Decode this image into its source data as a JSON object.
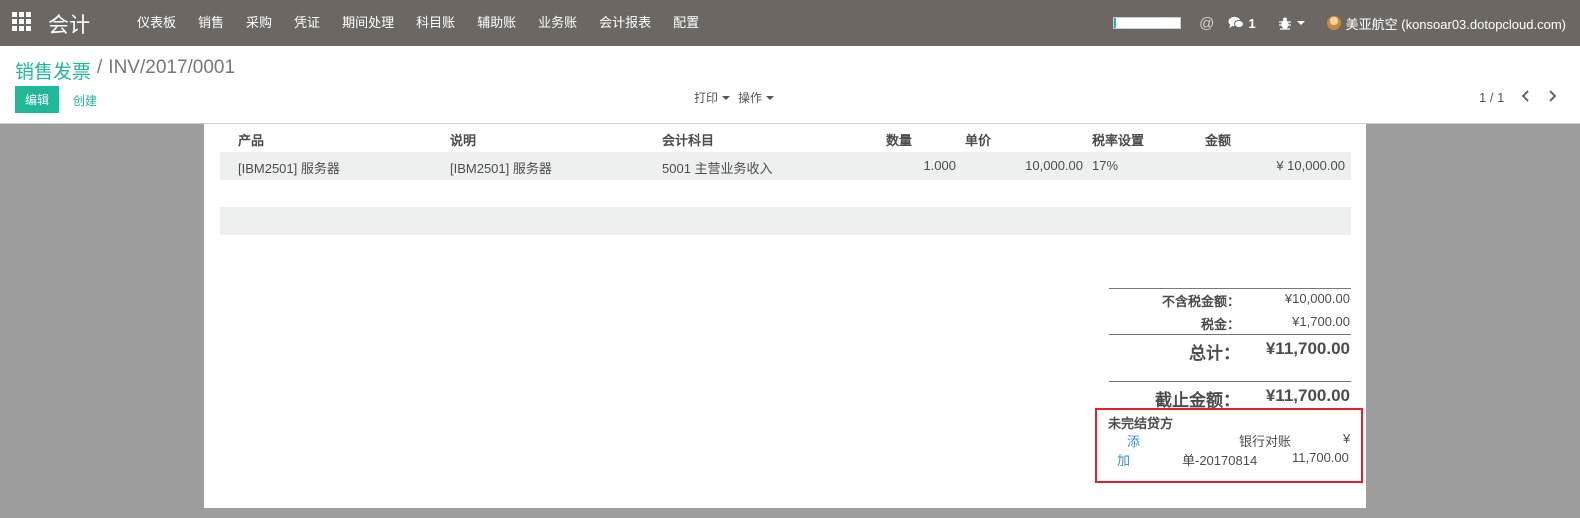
{
  "navbar": {
    "app_title": "会计",
    "menu": [
      "仪表板",
      "销售",
      "采购",
      "凭证",
      "期间处理",
      "科目账",
      "辅助账",
      "业务账",
      "会计报表",
      "配置"
    ],
    "progress_fraction": 0.03,
    "at_symbol": "@",
    "chat_count": "1",
    "user_name": "美亚航空 (konsoar03.dotopcloud.com)",
    "accent_color": "#21b799",
    "bar_color": "#6c6762"
  },
  "control": {
    "breadcrumb_parent": "销售发票",
    "breadcrumb_separator": "/",
    "breadcrumb_current": "INV/2017/0001",
    "edit_label": "编辑",
    "create_label": "创建",
    "print_label": "打印",
    "action_label": "操作",
    "pager_text": "1 / 1"
  },
  "lines": {
    "headers": {
      "product": "产品",
      "description": "说明",
      "account": "会计科目",
      "quantity": "数量",
      "unit_price": "单价",
      "tax": "税率设置",
      "amount": "金额"
    },
    "rows": [
      {
        "product": "[IBM2501] 服务器",
        "description": "[IBM2501] 服务器",
        "account": "5001 主营业务收入",
        "quantity": "1.000",
        "unit_price": "10,000.00",
        "tax": "17%",
        "amount": "¥ 10,000.00"
      }
    ]
  },
  "totals": {
    "untaxed_label": "不含税金额：",
    "untaxed_value": "¥10,000.00",
    "tax_label": "税金：",
    "tax_value": "¥1,700.00",
    "total_label": "总计：",
    "total_value": "¥11,700.00",
    "due_label": "截止金额：",
    "due_value": "¥11,700.00"
  },
  "outstanding": {
    "title": "未完结贷方",
    "add_label_1": "添",
    "add_label_2": "加",
    "desc_line_1": "银行对账",
    "desc_line_2": "单-20170814",
    "currency": "¥",
    "amount": "11,700.00",
    "highlight_color": "#e0202a"
  }
}
